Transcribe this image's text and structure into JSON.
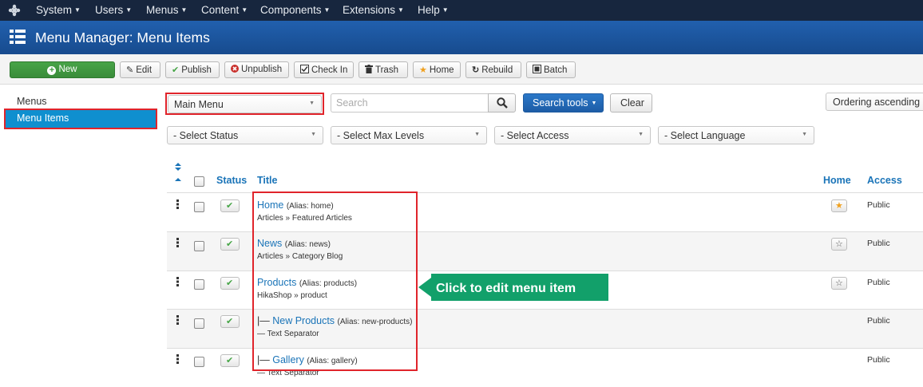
{
  "nav": {
    "items": [
      {
        "label": "System",
        "icon": "caret-down-icon"
      },
      {
        "label": "Users",
        "icon": "caret-down-icon"
      },
      {
        "label": "Menus",
        "icon": "caret-down-icon"
      },
      {
        "label": "Content",
        "icon": "caret-down-icon"
      },
      {
        "label": "Components",
        "icon": "caret-down-icon"
      },
      {
        "label": "Extensions",
        "icon": "caret-down-icon"
      },
      {
        "label": "Help",
        "icon": "caret-down-icon"
      }
    ]
  },
  "header": {
    "title": "Menu Manager: Menu Items",
    "icon": "list-icon"
  },
  "toolbar": {
    "new": "New",
    "edit": "Edit",
    "publish": "Publish",
    "unpublish": "Unpublish",
    "checkin": "Check In",
    "trash": "Trash",
    "home": "Home",
    "rebuild": "Rebuild",
    "batch": "Batch"
  },
  "sidebar": {
    "items": [
      {
        "label": "Menus",
        "active": false
      },
      {
        "label": "Menu Items",
        "active": true
      }
    ]
  },
  "filters": {
    "menu": "Main Menu",
    "search_placeholder": "Search",
    "search_tools": "Search tools",
    "clear": "Clear",
    "ordering": "Ordering ascending",
    "status": "- Select Status",
    "max_levels": "- Select Max Levels",
    "access": "- Select Access",
    "language": "- Select Language"
  },
  "table": {
    "headers": {
      "status": "Status",
      "title": "Title",
      "home": "Home",
      "access": "Access"
    },
    "rows": [
      {
        "prefix": "",
        "title": "Home",
        "alias": "(Alias: home)",
        "type": "Articles » Featured Articles",
        "home": "default",
        "access": "Public"
      },
      {
        "prefix": "",
        "title": "News",
        "alias": "(Alias: news)",
        "type": "Articles » Category Blog",
        "home": "not-default",
        "access": "Public"
      },
      {
        "prefix": "",
        "title": "Products",
        "alias": "(Alias: products)",
        "type": "HikaShop » product",
        "home": "not-default",
        "access": "Public"
      },
      {
        "prefix": "|— ",
        "title": "New Products",
        "alias": "(Alias: new-products)",
        "type": "— Text Separator",
        "home": "",
        "access": "Public"
      },
      {
        "prefix": "|— ",
        "title": "Gallery",
        "alias": "(Alias: gallery)",
        "type": "— Text Separator",
        "home": "",
        "access": "Public"
      }
    ]
  },
  "callout": {
    "text": "Click to edit menu item"
  },
  "colors": {
    "navbar": "#17263e",
    "header": "#1e58a3",
    "link": "#1a74b8",
    "new_button": "#47a447",
    "highlight": "#e0242b",
    "callout": "#12a06a"
  }
}
